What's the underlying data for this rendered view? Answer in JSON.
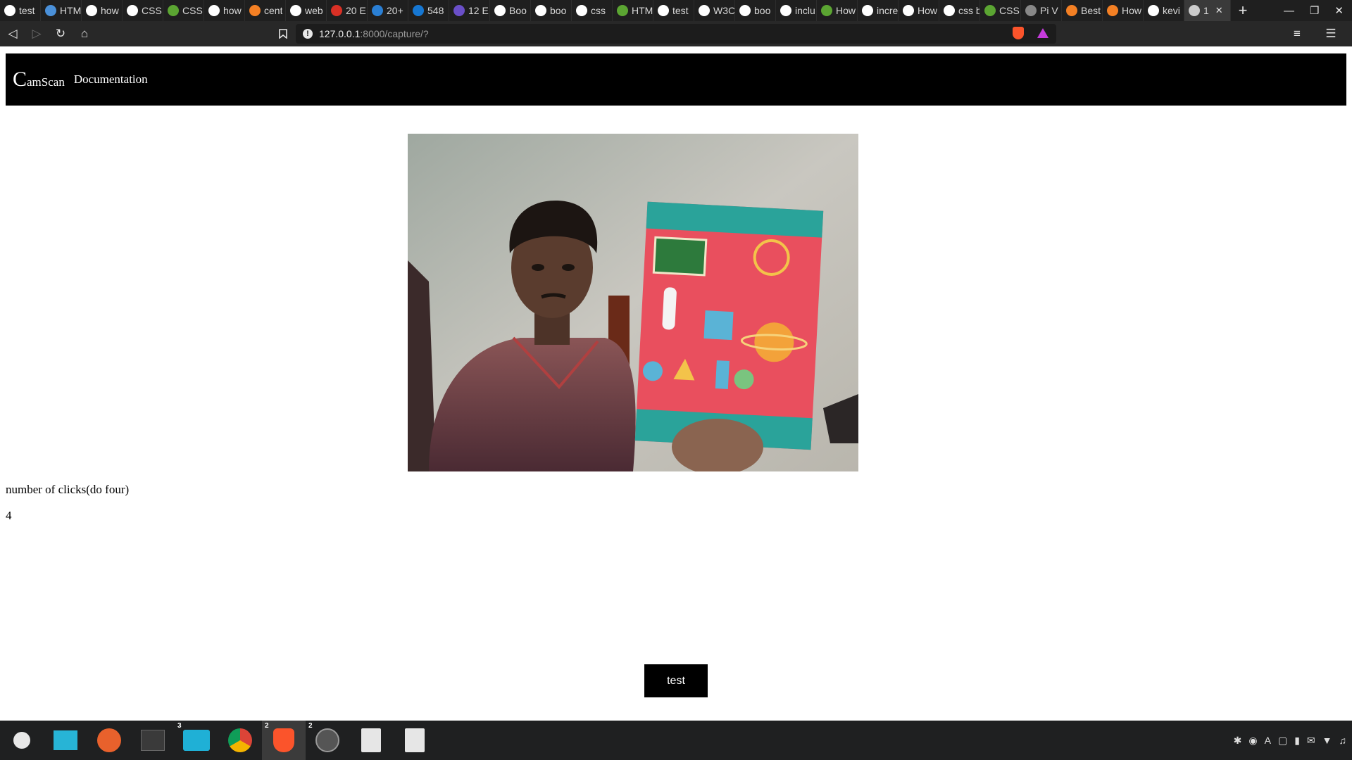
{
  "browser": {
    "tabs": [
      {
        "label": "test",
        "favicon": "google-icon",
        "color": "#ffffff"
      },
      {
        "label": "HTM",
        "favicon": "html-icon",
        "color": "#4a90d9"
      },
      {
        "label": "how",
        "favicon": "google-icon",
        "color": "#ffffff"
      },
      {
        "label": "CSS",
        "favicon": "w3schools-icon",
        "color": "#ffffff"
      },
      {
        "label": "CSS",
        "favicon": "css-tricks-icon",
        "color": "#5ba532"
      },
      {
        "label": "how",
        "favicon": "google-icon",
        "color": "#ffffff"
      },
      {
        "label": "cent",
        "favicon": "stackoverflow-icon",
        "color": "#f48024"
      },
      {
        "label": "web",
        "favicon": "google-icon",
        "color": "#ffffff"
      },
      {
        "label": "20 E",
        "favicon": "gmail-icon",
        "color": "#d93025"
      },
      {
        "label": "20+",
        "favicon": "arrow-icon",
        "color": "#2a7fd4"
      },
      {
        "label": "548",
        "favicon": "tm-icon",
        "color": "#1677d2"
      },
      {
        "label": "12 E",
        "favicon": "site-icon",
        "color": "#6a4fc8"
      },
      {
        "label": "Boo",
        "favicon": "github-icon",
        "color": "#ffffff"
      },
      {
        "label": "boo",
        "favicon": "github-icon",
        "color": "#ffffff"
      },
      {
        "label": "css",
        "favicon": "google-icon",
        "color": "#ffffff"
      },
      {
        "label": "HTM",
        "favicon": "css-tricks-icon",
        "color": "#5ba532"
      },
      {
        "label": "test",
        "favicon": "google-icon",
        "color": "#ffffff"
      },
      {
        "label": "W3C",
        "favicon": "w3c-icon",
        "color": "#ffffff"
      },
      {
        "label": "boo",
        "favicon": "github-icon",
        "color": "#ffffff"
      },
      {
        "label": "inclu",
        "favicon": "google-icon",
        "color": "#ffffff"
      },
      {
        "label": "How",
        "favicon": "css-tricks-icon",
        "color": "#5ba532"
      },
      {
        "label": "incre",
        "favicon": "google-icon",
        "color": "#ffffff"
      },
      {
        "label": "How",
        "favicon": "github-icon",
        "color": "#ffffff"
      },
      {
        "label": "css b",
        "favicon": "google-icon",
        "color": "#ffffff"
      },
      {
        "label": "CSS",
        "favicon": "css-tricks-icon",
        "color": "#5ba532"
      },
      {
        "label": "Pi V",
        "favicon": "globe-icon",
        "color": "#888888"
      },
      {
        "label": "Best",
        "favicon": "stackoverflow-icon",
        "color": "#f48024"
      },
      {
        "label": "How",
        "favicon": "stackoverflow-icon",
        "color": "#f48024"
      },
      {
        "label": "kevi",
        "favicon": "github-icon",
        "color": "#ffffff"
      },
      {
        "label": "1",
        "favicon": "globe-icon",
        "color": "#cccccc",
        "active": true
      }
    ],
    "new_tab": "+",
    "url_host": "127.0.0.1",
    "url_path": ":8000/capture/?"
  },
  "page": {
    "brand_initial": "C",
    "brand_rest": "amScan",
    "nav_documentation": "Documentation",
    "click_label": "number of clicks(do four)",
    "click_count": "4",
    "test_button": "test",
    "accent_color": "#000000"
  },
  "taskbar": {
    "items": [
      {
        "name": "mint-menu-icon",
        "badge": ""
      },
      {
        "name": "show-desktop-icon",
        "badge": ""
      },
      {
        "name": "firefox-icon",
        "badge": ""
      },
      {
        "name": "terminal-icon",
        "badge": ""
      },
      {
        "name": "files-icon",
        "badge": "3"
      },
      {
        "name": "chrome-icon",
        "badge": ""
      },
      {
        "name": "brave-icon",
        "badge": "2",
        "active": true
      },
      {
        "name": "atom-icon",
        "badge": "2"
      },
      {
        "name": "text-editor-icon",
        "badge": ""
      },
      {
        "name": "text-editor-icon",
        "badge": ""
      }
    ]
  }
}
